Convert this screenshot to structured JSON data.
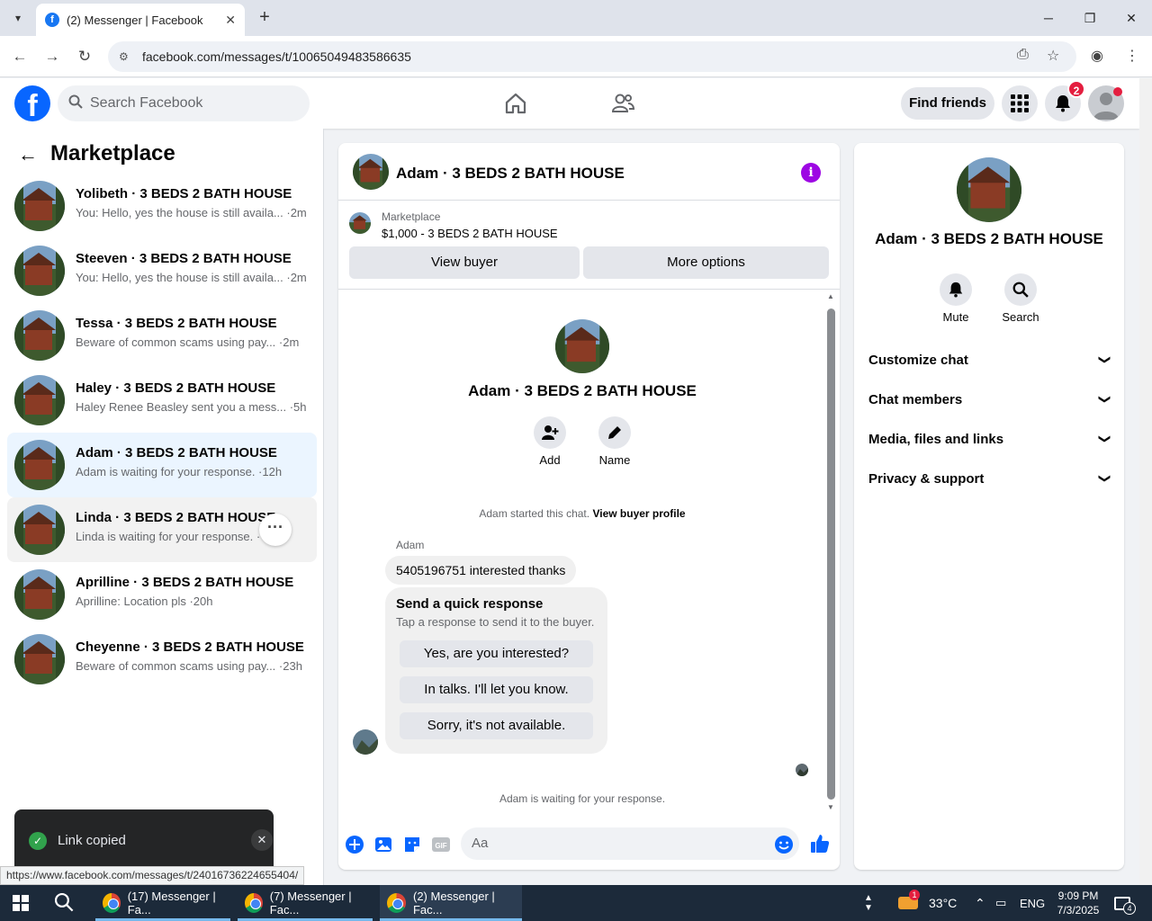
{
  "browser": {
    "tab_title": "(2) Messenger | Facebook",
    "favicon_letter": "f",
    "url": "facebook.com/messages/t/10065049483586635",
    "status_url": "https://www.facebook.com/messages/t/24016736224655404/"
  },
  "fb_header": {
    "logo_letter": "f",
    "search_placeholder": "Search Facebook",
    "find_friends_label": "Find friends",
    "notification_count": "2"
  },
  "left_panel": {
    "title": "Marketplace",
    "conversations": [
      {
        "name": "Yolibeth · 3 BEDS 2 BATH HOUSE",
        "preview": "You: Hello, yes the house is still availa... ·2m"
      },
      {
        "name": "Steeven · 3 BEDS 2 BATH HOUSE",
        "preview": "You: Hello, yes the house is still availa... ·2m"
      },
      {
        "name": "Tessa · 3 BEDS 2 BATH HOUSE",
        "preview": "Beware of common scams using pay... ·2m"
      },
      {
        "name": "Haley · 3 BEDS 2 BATH HOUSE",
        "preview": "Haley Renee Beasley sent you a mess... ·5h"
      },
      {
        "name": "Adam · 3 BEDS 2 BATH HOUSE",
        "preview": "Adam is waiting for your response. ·12h"
      },
      {
        "name": "Linda · 3 BEDS 2 BATH HOUSE",
        "preview": "Linda is waiting for your response. · 1"
      },
      {
        "name": "Aprilline · 3 BEDS 2 BATH HOUSE",
        "preview": "Aprilline: Location pls ·20h"
      },
      {
        "name": "Cheyenne · 3 BEDS 2 BATH HOUSE",
        "preview": "Beware of common scams using pay... ·23h"
      }
    ]
  },
  "chat": {
    "title": "Adam · 3 BEDS 2 BATH HOUSE",
    "info_glyph": "i",
    "marketplace_label": "Marketplace",
    "listing": "$1,000 - 3 BEDS 2 BATH HOUSE",
    "view_buyer_label": "View buyer",
    "more_options_label": "More options",
    "profile_name": "Adam · 3 BEDS 2 BATH HOUSE",
    "add_label": "Add",
    "name_label": "Name",
    "started_text": "Adam started this chat.",
    "view_buyer_profile_label": "View buyer profile",
    "sender": "Adam",
    "message": "5405196751 interested thanks",
    "quick_title": "Send a quick response",
    "quick_subtitle": "Tap a response to send it to the buyer.",
    "quick_responses": [
      "Yes, are you interested?",
      "In talks. I'll let you know.",
      "Sorry, it's not available."
    ],
    "waiting_text": "Adam is waiting for your response.",
    "input_placeholder": "Aa"
  },
  "right_panel": {
    "name": "Adam · 3 BEDS 2 BATH HOUSE",
    "mute_label": "Mute",
    "search_label": "Search",
    "sections": [
      "Customize chat",
      "Chat members",
      "Media, files and links",
      "Privacy & support"
    ]
  },
  "toast": {
    "text": "Link copied"
  },
  "taskbar": {
    "apps": [
      "(17) Messenger | Fa...",
      "(7) Messenger | Fac...",
      "(2) Messenger | Fac..."
    ],
    "weather_badge": "1",
    "temperature": "33°C",
    "language": "ENG",
    "time": "9:09 PM",
    "date": "7/3/2025",
    "notif_count": "4"
  },
  "colors": {
    "brand": "#0866ff",
    "info_purple": "#9d06e3",
    "active_conv": "#ebf5ff",
    "toast_bg": "#242526",
    "success": "#31a24c"
  }
}
